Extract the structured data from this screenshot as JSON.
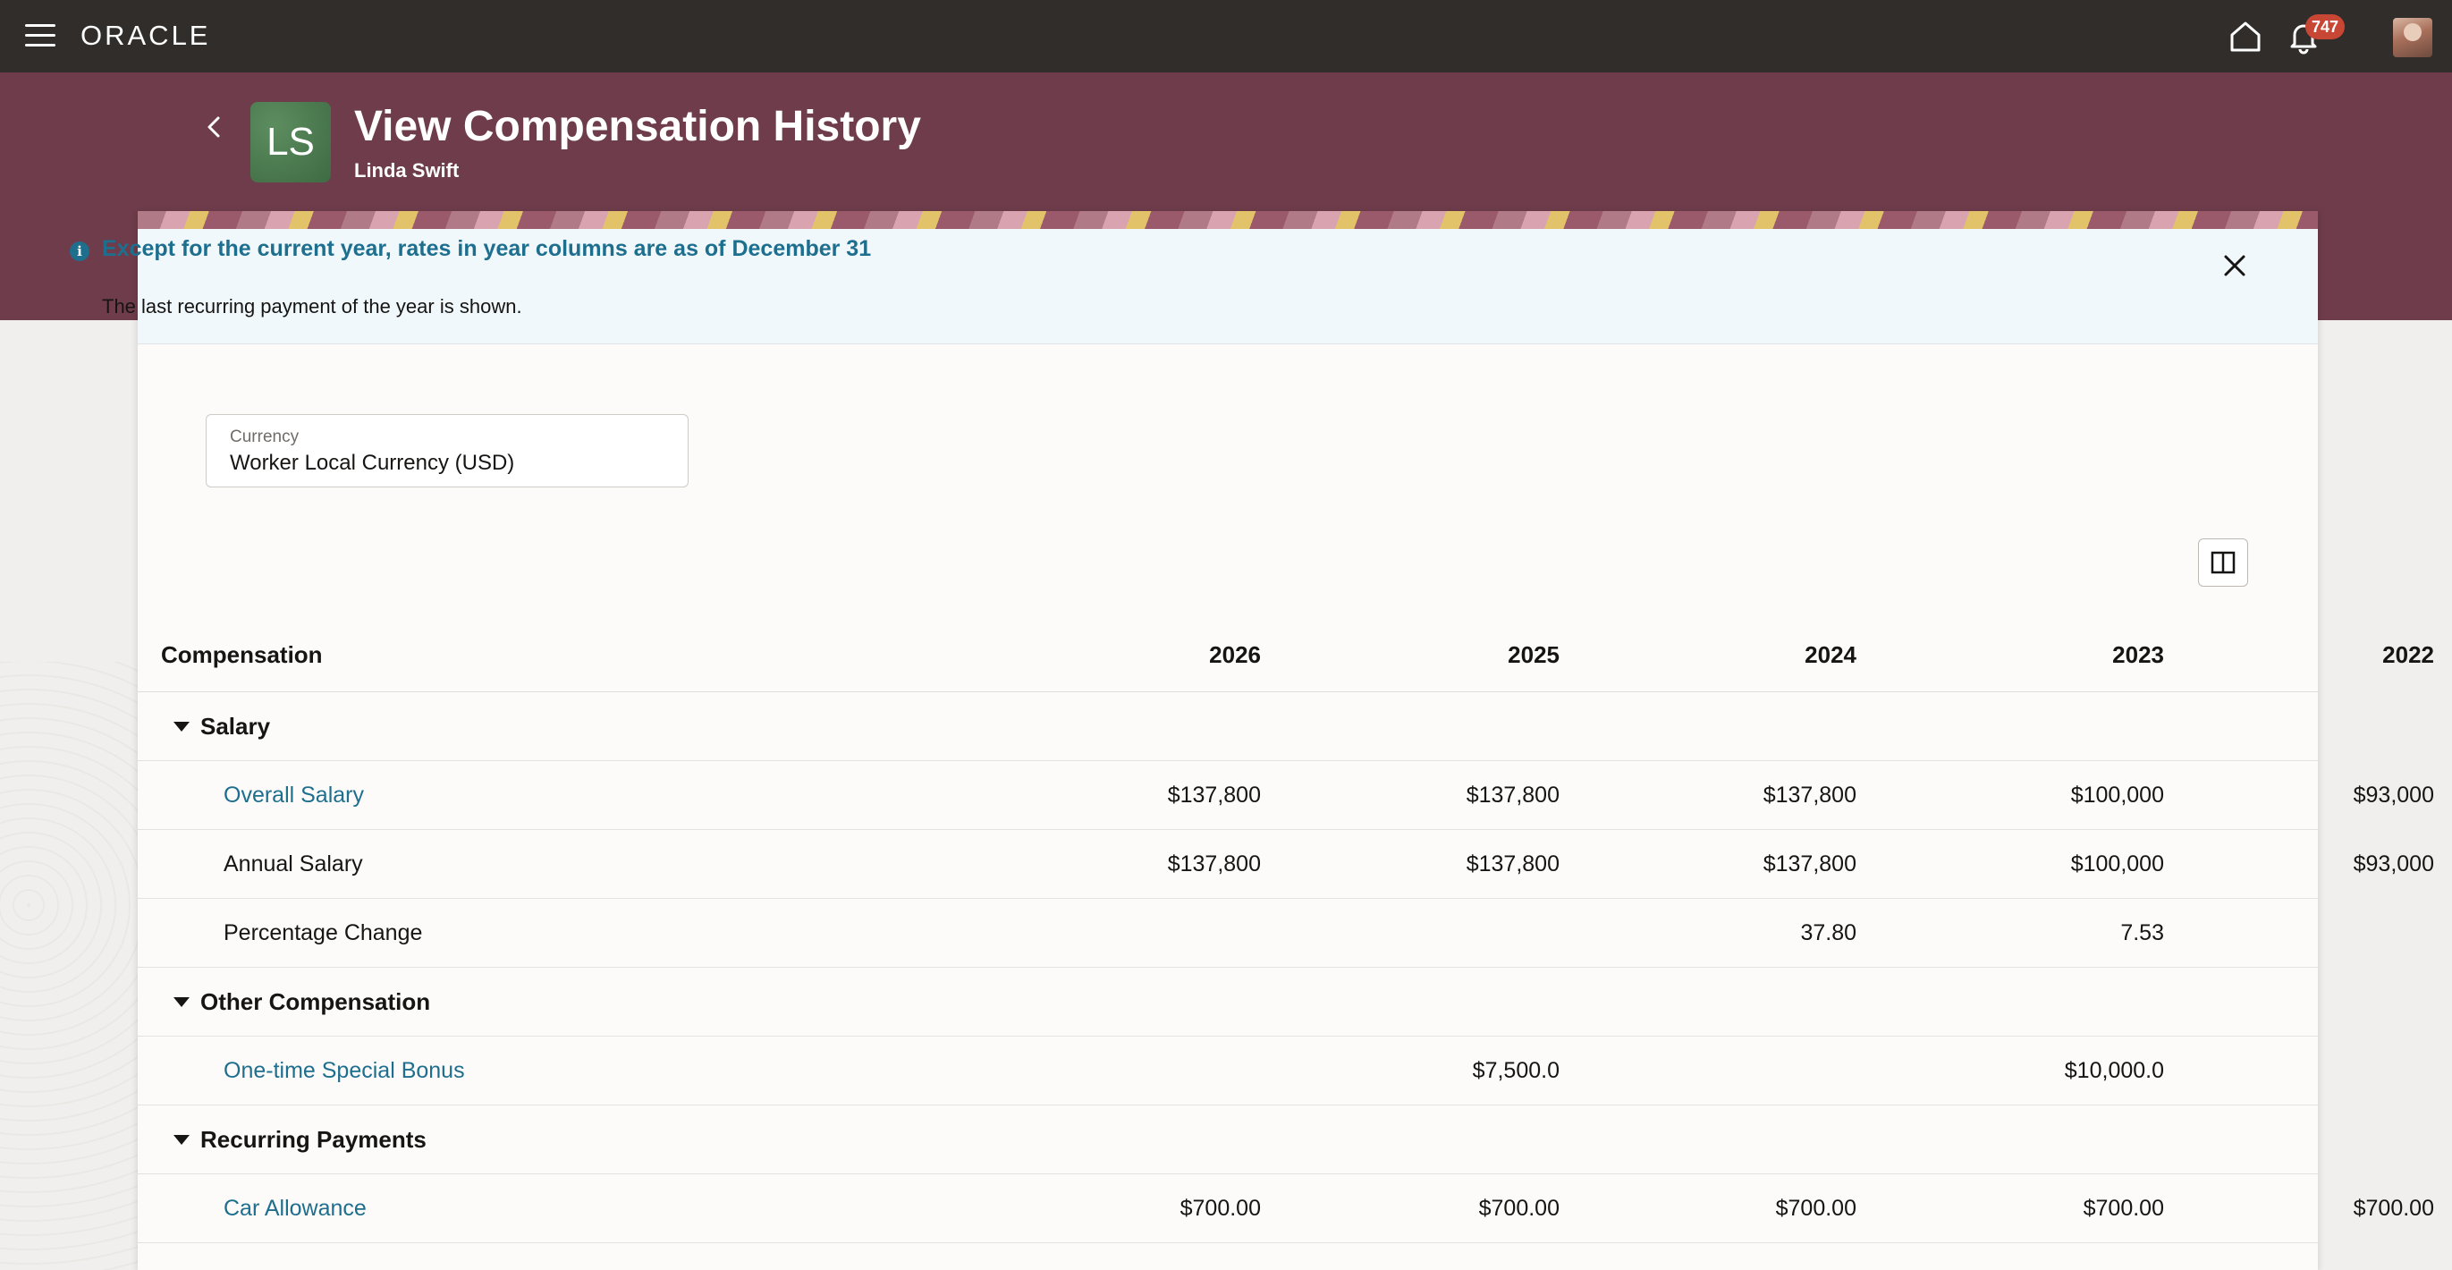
{
  "nav": {
    "logo": "ORACLE",
    "notification_count": "747"
  },
  "header": {
    "avatar_initials": "LS",
    "title": "View Compensation History",
    "subtitle": "Linda Swift"
  },
  "info": {
    "title": "Except for the current year, rates in year columns are as of December 31",
    "body": "The last recurring payment of the year is shown."
  },
  "currency": {
    "label": "Currency",
    "value": "Worker Local Currency (USD)"
  },
  "table": {
    "columns": [
      "Compensation",
      "2026",
      "2025",
      "2024",
      "2023",
      "2022"
    ],
    "groups": [
      {
        "name": "Salary",
        "rows": [
          {
            "label": "Overall Salary",
            "link": true,
            "values": [
              "$137,800",
              "$137,800",
              "$137,800",
              "$100,000",
              "$93,000"
            ]
          },
          {
            "label": "Annual Salary",
            "link": false,
            "values": [
              "$137,800",
              "$137,800",
              "$137,800",
              "$100,000",
              "$93,000"
            ]
          },
          {
            "label": "Percentage Change",
            "link": false,
            "values": [
              "",
              "",
              "37.80",
              "7.53",
              ""
            ]
          }
        ]
      },
      {
        "name": "Other Compensation",
        "rows": [
          {
            "label": "One-time Special Bonus",
            "link": true,
            "values": [
              "",
              "$7,500.0",
              "",
              "$10,000.0",
              ""
            ]
          }
        ]
      },
      {
        "name": "Recurring Payments",
        "rows": [
          {
            "label": "Car Allowance",
            "link": true,
            "values": [
              "$700.00",
              "$700.00",
              "$700.00",
              "$700.00",
              "$700.00"
            ]
          }
        ]
      }
    ]
  },
  "colors": {
    "topbar": "#312d2a",
    "header_band": "#6e3c4b",
    "link": "#1e6e8e",
    "badge": "#c74634",
    "avatar": "#4f7d52"
  }
}
